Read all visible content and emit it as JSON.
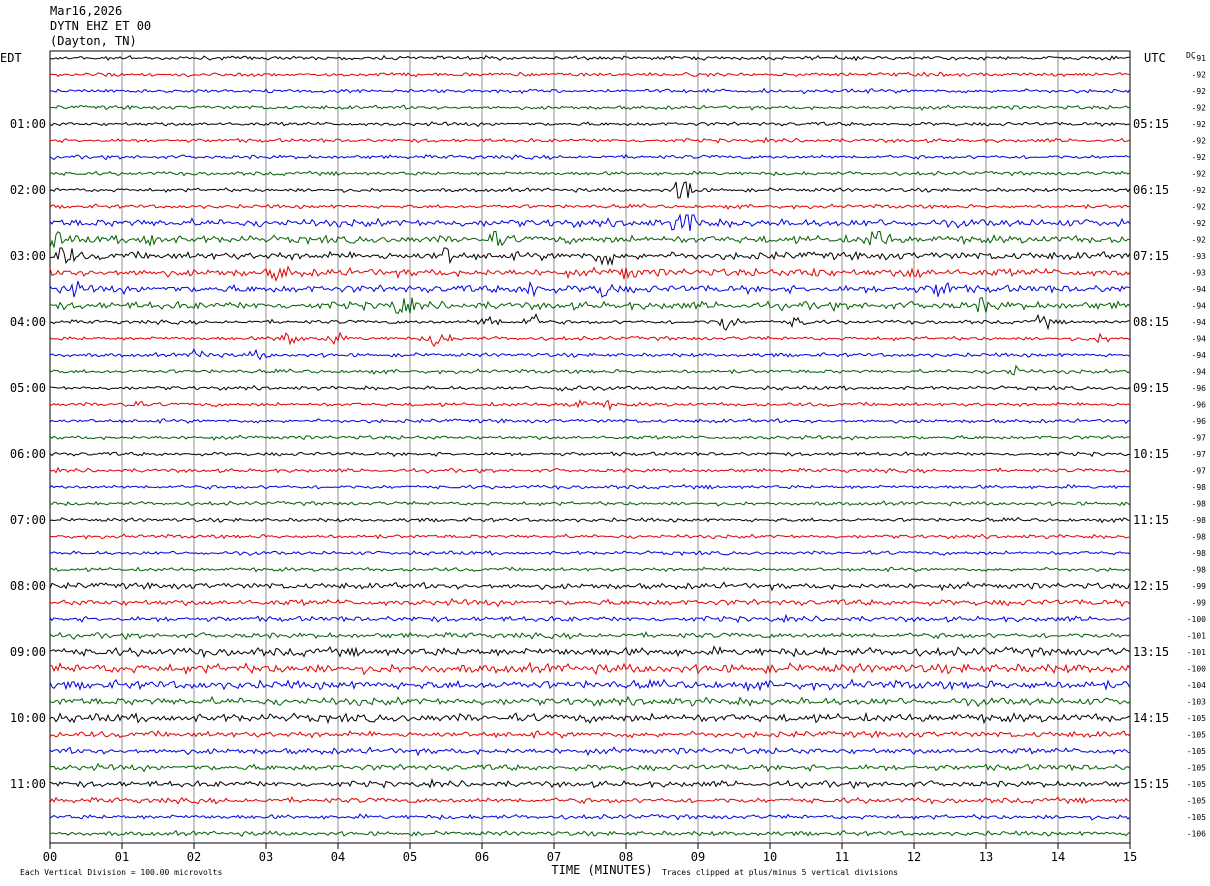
{
  "header": {
    "date": "Mar16,2026",
    "station": "DYTN EHZ ET 00",
    "location": "(Dayton, TN)"
  },
  "chart_data": {
    "type": "line",
    "left_label": "EDT",
    "right_label": "UTC",
    "dc_label": "DC",
    "xlabel": "TIME (MINUTES)",
    "x_ticks": [
      "00",
      "01",
      "02",
      "03",
      "04",
      "05",
      "06",
      "07",
      "08",
      "09",
      "10",
      "11",
      "12",
      "13",
      "14",
      "15"
    ],
    "xlim": [
      0,
      15
    ],
    "footer_left": "Each Vertical Division =  100.00 microvolts",
    "footer_right": "Traces clipped at plus/minus 5 vertical divisions",
    "trace_colors": [
      "#000000",
      "#e00000",
      "#0000e0",
      "#006000"
    ],
    "left_hours": [
      {
        "row": 4,
        "label": "01:00"
      },
      {
        "row": 8,
        "label": "02:00"
      },
      {
        "row": 12,
        "label": "03:00"
      },
      {
        "row": 16,
        "label": "04:00"
      },
      {
        "row": 20,
        "label": "05:00"
      },
      {
        "row": 24,
        "label": "06:00"
      },
      {
        "row": 28,
        "label": "07:00"
      },
      {
        "row": 32,
        "label": "08:00"
      },
      {
        "row": 36,
        "label": "09:00"
      },
      {
        "row": 40,
        "label": "10:00"
      },
      {
        "row": 44,
        "label": "11:00"
      }
    ],
    "right_hours": [
      {
        "row": 4,
        "label": "05:15"
      },
      {
        "row": 8,
        "label": "06:15"
      },
      {
        "row": 12,
        "label": "07:15"
      },
      {
        "row": 16,
        "label": "08:15"
      },
      {
        "row": 20,
        "label": "09:15"
      },
      {
        "row": 24,
        "label": "10:15"
      },
      {
        "row": 28,
        "label": "11:15"
      },
      {
        "row": 32,
        "label": "12:15"
      },
      {
        "row": 36,
        "label": "13:15"
      },
      {
        "row": 40,
        "label": "14:15"
      },
      {
        "row": 44,
        "label": "15:15"
      }
    ],
    "dc_offsets": [
      "-91",
      "-92",
      "-92",
      "-92",
      "-92",
      "-92",
      "-92",
      "-92",
      "-92",
      "-92",
      "-92",
      "-92",
      "-93",
      "-93",
      "-94",
      "-94",
      "-94",
      "-94",
      "-94",
      "-94",
      "-96",
      "-96",
      "-96",
      "-97",
      "-97",
      "-97",
      "-98",
      "-98",
      "-98",
      "-98",
      "-98",
      "-98",
      "-99",
      "-99",
      "-100",
      "-101",
      "-101",
      "-100",
      "-104",
      "-103",
      "-105",
      "-105",
      "-105",
      "-105",
      "-105",
      "-105",
      "-105",
      "-106"
    ],
    "trace_activity": [
      1,
      1,
      1,
      1,
      1,
      1,
      1,
      1,
      1,
      1,
      2,
      2,
      2,
      2,
      2,
      2,
      1,
      1,
      1,
      1,
      1,
      1,
      1,
      1,
      1,
      1,
      1,
      1,
      1,
      1,
      1,
      1,
      1.6,
      1.6,
      1.4,
      1.4,
      2.2,
      2.4,
      2.2,
      2.0,
      2.2,
      1.6,
      1.6,
      1.6,
      1.6,
      1.4,
      1.2,
      1.2
    ],
    "events": [
      {
        "row": 8,
        "minute": 8.82,
        "amp": 6
      },
      {
        "row": 10,
        "minute": 8.82,
        "amp": 5
      },
      {
        "row": 10,
        "minute": 8.9,
        "amp": 2
      },
      {
        "row": 11,
        "minute": 0.1,
        "amp": 3
      },
      {
        "row": 11,
        "minute": 1.4,
        "amp": 2
      },
      {
        "row": 11,
        "minute": 6.2,
        "amp": 2
      },
      {
        "row": 11,
        "minute": 11.5,
        "amp": 4
      },
      {
        "row": 12,
        "minute": 0.2,
        "amp": 3
      },
      {
        "row": 12,
        "minute": 5.5,
        "amp": 3
      },
      {
        "row": 12,
        "minute": 7.7,
        "amp": 3
      },
      {
        "row": 13,
        "minute": 3.2,
        "amp": 2
      },
      {
        "row": 13,
        "minute": 8.0,
        "amp": 2
      },
      {
        "row": 13,
        "minute": 10.6,
        "amp": 1.5
      },
      {
        "row": 13,
        "minute": 12.0,
        "amp": 1.5
      },
      {
        "row": 14,
        "minute": 0.3,
        "amp": 2
      },
      {
        "row": 14,
        "minute": 6.7,
        "amp": 3
      },
      {
        "row": 14,
        "minute": 7.7,
        "amp": 3
      },
      {
        "row": 14,
        "minute": 12.4,
        "amp": 3
      },
      {
        "row": 15,
        "minute": 4.9,
        "amp": 4
      },
      {
        "row": 15,
        "minute": 13.0,
        "amp": 2
      },
      {
        "row": 16,
        "minute": 6.1,
        "amp": 2
      },
      {
        "row": 16,
        "minute": 6.7,
        "amp": 2
      },
      {
        "row": 16,
        "minute": 9.4,
        "amp": 3
      },
      {
        "row": 16,
        "minute": 10.4,
        "amp": 1.5
      },
      {
        "row": 16,
        "minute": 13.8,
        "amp": 1.5
      },
      {
        "row": 17,
        "minute": 3.3,
        "amp": 3
      },
      {
        "row": 17,
        "minute": 3.9,
        "amp": 2
      },
      {
        "row": 17,
        "minute": 5.4,
        "amp": 3
      },
      {
        "row": 17,
        "minute": 14.6,
        "amp": 1
      },
      {
        "row": 18,
        "minute": 2.1,
        "amp": 2
      },
      {
        "row": 18,
        "minute": 2.9,
        "amp": 1
      },
      {
        "row": 19,
        "minute": 13.4,
        "amp": 1.5
      },
      {
        "row": 20,
        "minute": 7.2,
        "amp": 1.5
      },
      {
        "row": 21,
        "minute": 1.1,
        "amp": 1.5
      },
      {
        "row": 21,
        "minute": 7.3,
        "amp": 1.5
      },
      {
        "row": 21,
        "minute": 7.7,
        "amp": 1
      }
    ]
  }
}
